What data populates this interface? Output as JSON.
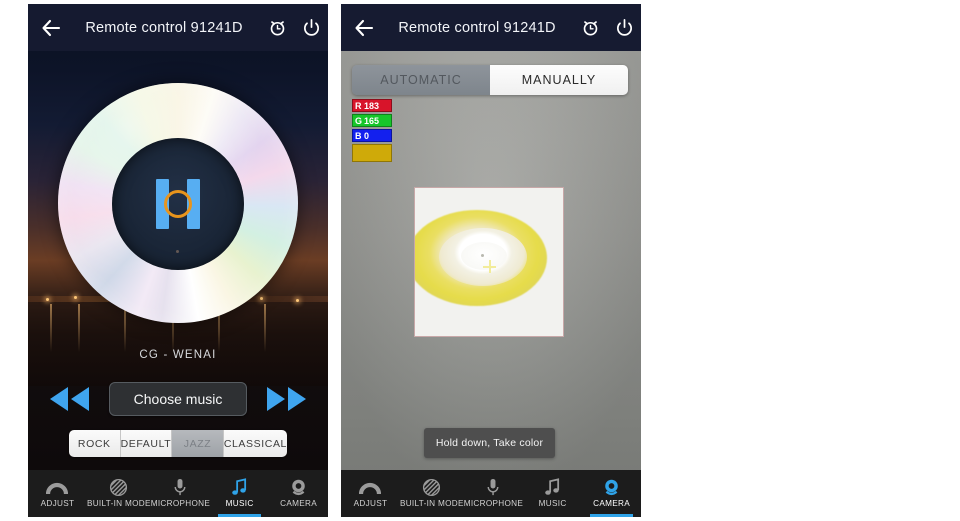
{
  "header": {
    "back_icon": "back-arrow-icon",
    "title": "Remote control 91241D",
    "alarm_icon": "alarm-clock-icon",
    "power_icon": "power-icon"
  },
  "left_phone": {
    "screen": "music",
    "track_title": "CG - WENAI",
    "logo_letter": "H",
    "prev_label": "prev-track",
    "next_label": "next-track",
    "choose_music_label": "Choose music",
    "equalizer": {
      "options": [
        "ROCK",
        "DEFAULT",
        "JAZZ",
        "CLASSICAL"
      ],
      "selected": "JAZZ"
    },
    "accent_color": "#2fa3e8",
    "nav": {
      "items": [
        {
          "label": "ADJUST",
          "icon": "arc-adjust-icon"
        },
        {
          "label": "BUILT-IN MODE",
          "icon": "hatched-circle-icon"
        },
        {
          "label": "MICROPHONE",
          "icon": "microphone-icon"
        },
        {
          "label": "MUSIC",
          "icon": "music-note-icon"
        },
        {
          "label": "CAMERA",
          "icon": "webcam-icon"
        }
      ],
      "active": "MUSIC"
    }
  },
  "right_phone": {
    "screen": "camera",
    "mode_tabs": {
      "options": [
        "AUTOMATIC",
        "MANUALLY"
      ],
      "selected": "MANUALLY"
    },
    "rgb": {
      "r_key": "R",
      "r_value": "183",
      "g_key": "G",
      "g_value": "165",
      "b_key": "B",
      "b_value": "0",
      "swatch_color": "#cfaa09"
    },
    "preview": {
      "subject": "yellow-tape-roll",
      "crosshair": "color-picker-crosshair"
    },
    "hold_button_label": "Hold down, Take color",
    "accent_color": "#2fa3e8",
    "nav": {
      "items": [
        {
          "label": "ADJUST",
          "icon": "arc-adjust-icon"
        },
        {
          "label": "BUILT-IN MODE",
          "icon": "hatched-circle-icon"
        },
        {
          "label": "MICROPHONE",
          "icon": "microphone-icon"
        },
        {
          "label": "MUSIC",
          "icon": "music-note-icon"
        },
        {
          "label": "CAMERA",
          "icon": "webcam-icon"
        }
      ],
      "active": "CAMERA"
    }
  }
}
